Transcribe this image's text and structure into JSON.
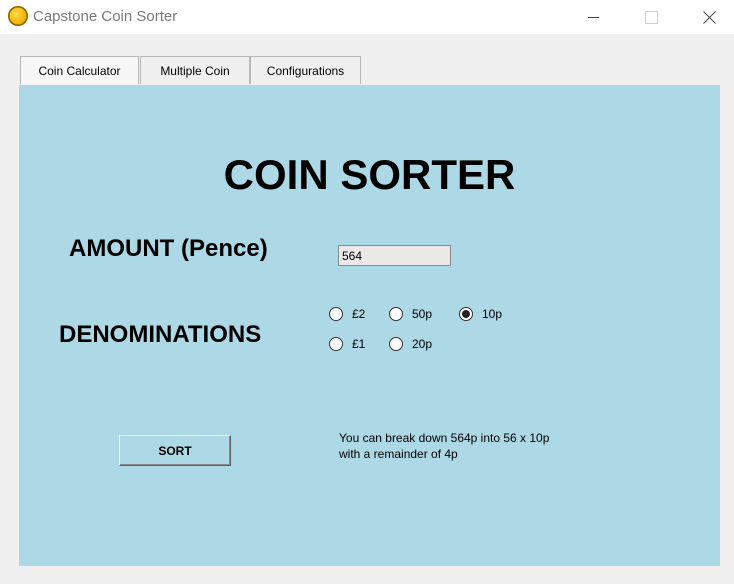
{
  "window": {
    "title": "Capstone Coin Sorter",
    "icon": "coin-icon",
    "controls": {
      "minimize": "minimize-icon",
      "maximize": "maximize-icon",
      "close": "close-icon"
    }
  },
  "tabs": [
    {
      "label": "Coin Calculator",
      "active": true
    },
    {
      "label": "Multiple Coin",
      "active": false
    },
    {
      "label": "Configurations",
      "active": false
    }
  ],
  "panel": {
    "background": "#add8e6",
    "heading": "COIN SORTER",
    "amount_label": "AMOUNT (Pence)",
    "amount_value": "564",
    "denominations_label": "DENOMINATIONS",
    "denominations": [
      {
        "label": "£2",
        "selected": false
      },
      {
        "label": "50p",
        "selected": false
      },
      {
        "label": "10p",
        "selected": true
      },
      {
        "label": "£1",
        "selected": false
      },
      {
        "label": "20p",
        "selected": false
      }
    ],
    "sort_button": "SORT",
    "result_line1": "You can break down 564p into 56 x 10p",
    "result_line2": "with a remainder of 4p"
  }
}
